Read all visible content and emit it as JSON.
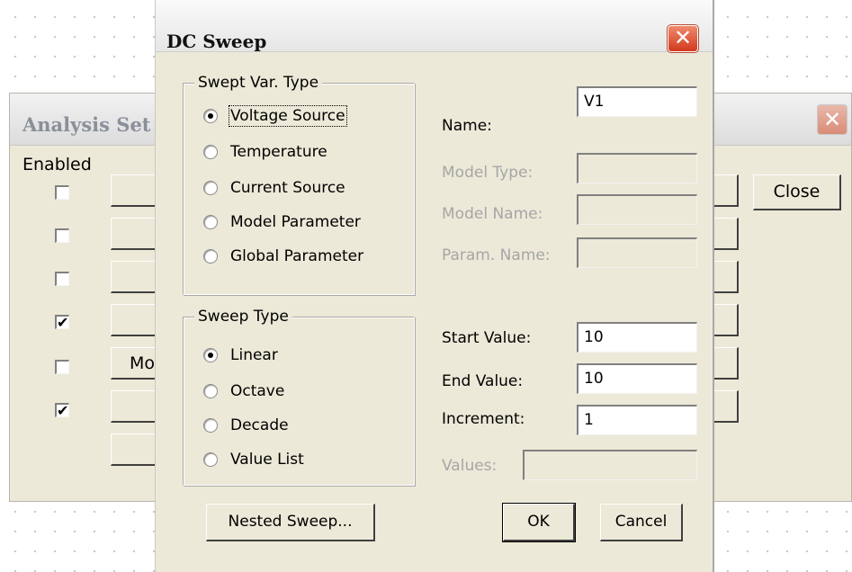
{
  "analysis_setup": {
    "title": "Analysis Set",
    "enabled_label": "Enabled",
    "rows": [
      {
        "checked": false,
        "button_text": ""
      },
      {
        "checked": false,
        "button_text": ""
      },
      {
        "checked": false,
        "button_text": ""
      },
      {
        "checked": true,
        "button_text": ""
      },
      {
        "checked": false,
        "button_text": "Mo"
      },
      {
        "checked": true,
        "button_text": ""
      },
      {
        "button_text": ""
      }
    ],
    "check_mark": "✔",
    "close_label": "Close",
    "close_glyph": "✕"
  },
  "dc_sweep": {
    "title": "DC Sweep",
    "close_glyph": "✕",
    "swept_var_type": {
      "legend": "Swept Var. Type",
      "options": [
        {
          "label": "Voltage Source",
          "selected": true
        },
        {
          "label": "Temperature",
          "selected": false
        },
        {
          "label": "Current Source",
          "selected": false
        },
        {
          "label": "Model Parameter",
          "selected": false
        },
        {
          "label": "Global Parameter",
          "selected": false
        }
      ]
    },
    "name": {
      "label": "Name:",
      "value": "V1"
    },
    "model_type": {
      "label": "Model Type:",
      "value": ""
    },
    "model_name": {
      "label": "Model Name:",
      "value": ""
    },
    "param_name": {
      "label": "Param. Name:",
      "value": ""
    },
    "sweep_type": {
      "legend": "Sweep Type",
      "options": [
        {
          "label": "Linear",
          "selected": true
        },
        {
          "label": "Octave",
          "selected": false
        },
        {
          "label": "Decade",
          "selected": false
        },
        {
          "label": "Value List",
          "selected": false
        }
      ]
    },
    "start_value": {
      "label": "Start Value:",
      "value": "10"
    },
    "end_value": {
      "label": "End Value:",
      "value": "10"
    },
    "increment": {
      "label": "Increment:",
      "value": "1"
    },
    "values": {
      "label": "Values:",
      "value": ""
    },
    "buttons": {
      "nested_sweep": "Nested Sweep...",
      "ok": "OK",
      "cancel": "Cancel"
    }
  }
}
